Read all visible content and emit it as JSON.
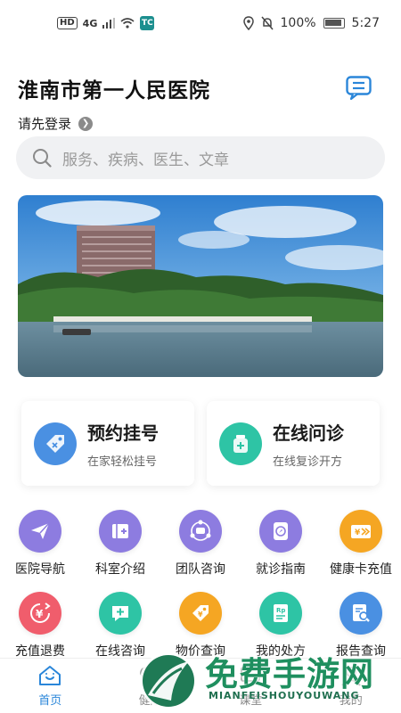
{
  "status_bar": {
    "hd": "HD",
    "network": "4G",
    "battery": "100%",
    "time": "5:27"
  },
  "header": {
    "title": "淮南市第一人民医院",
    "login": "请先登录"
  },
  "search": {
    "placeholder": "服务、疾病、医生、文章"
  },
  "cards": [
    {
      "title": "预约挂号",
      "subtitle": "在家轻松挂号",
      "icon": "tag-icon",
      "color": "#4a90e2"
    },
    {
      "title": "在线问诊",
      "subtitle": "在线复诊开方",
      "icon": "medicine-bottle-icon",
      "color": "#2ec4a5"
    }
  ],
  "grid_row1": [
    {
      "label": "医院导航",
      "icon": "paper-plane-icon",
      "color": "#8d7ce0"
    },
    {
      "label": "科室介绍",
      "icon": "building-icon",
      "color": "#8d7ce0"
    },
    {
      "label": "团队咨询",
      "icon": "team-chat-icon",
      "color": "#8d7ce0"
    },
    {
      "label": "就诊指南",
      "icon": "compass-icon",
      "color": "#8d7ce0"
    },
    {
      "label": "健康卡充值",
      "icon": "card-yen-icon",
      "color": "#f5a623"
    }
  ],
  "grid_row2": [
    {
      "label": "充值退费",
      "icon": "yen-refund-icon",
      "color": "#f05d6c"
    },
    {
      "label": "在线咨询",
      "icon": "chat-plus-icon",
      "color": "#2ec4a5"
    },
    {
      "label": "物价查询",
      "icon": "price-tag-icon",
      "color": "#f5a623"
    },
    {
      "label": "我的处方",
      "icon": "prescription-icon",
      "color": "#2ec4a5"
    },
    {
      "label": "报告查询",
      "icon": "report-search-icon",
      "color": "#4a90e2"
    }
  ],
  "tabs": [
    {
      "label": "首页",
      "icon": "home-icon",
      "active": true
    },
    {
      "label": "健康",
      "icon": "health-icon",
      "active": false
    },
    {
      "label": "课堂",
      "icon": "classroom-icon",
      "active": false
    },
    {
      "label": "我的",
      "icon": "profile-icon",
      "active": false
    }
  ],
  "watermark": {
    "title": "免费手游网",
    "subtitle": "MIANFEISHOUYOUWANG"
  },
  "colors": {
    "accent": "#2a86d9",
    "grid_purple": "#8d7ce0",
    "teal": "#2ec4a5",
    "orange": "#f5a623",
    "red": "#f05d6c",
    "blue": "#4a90e2"
  }
}
